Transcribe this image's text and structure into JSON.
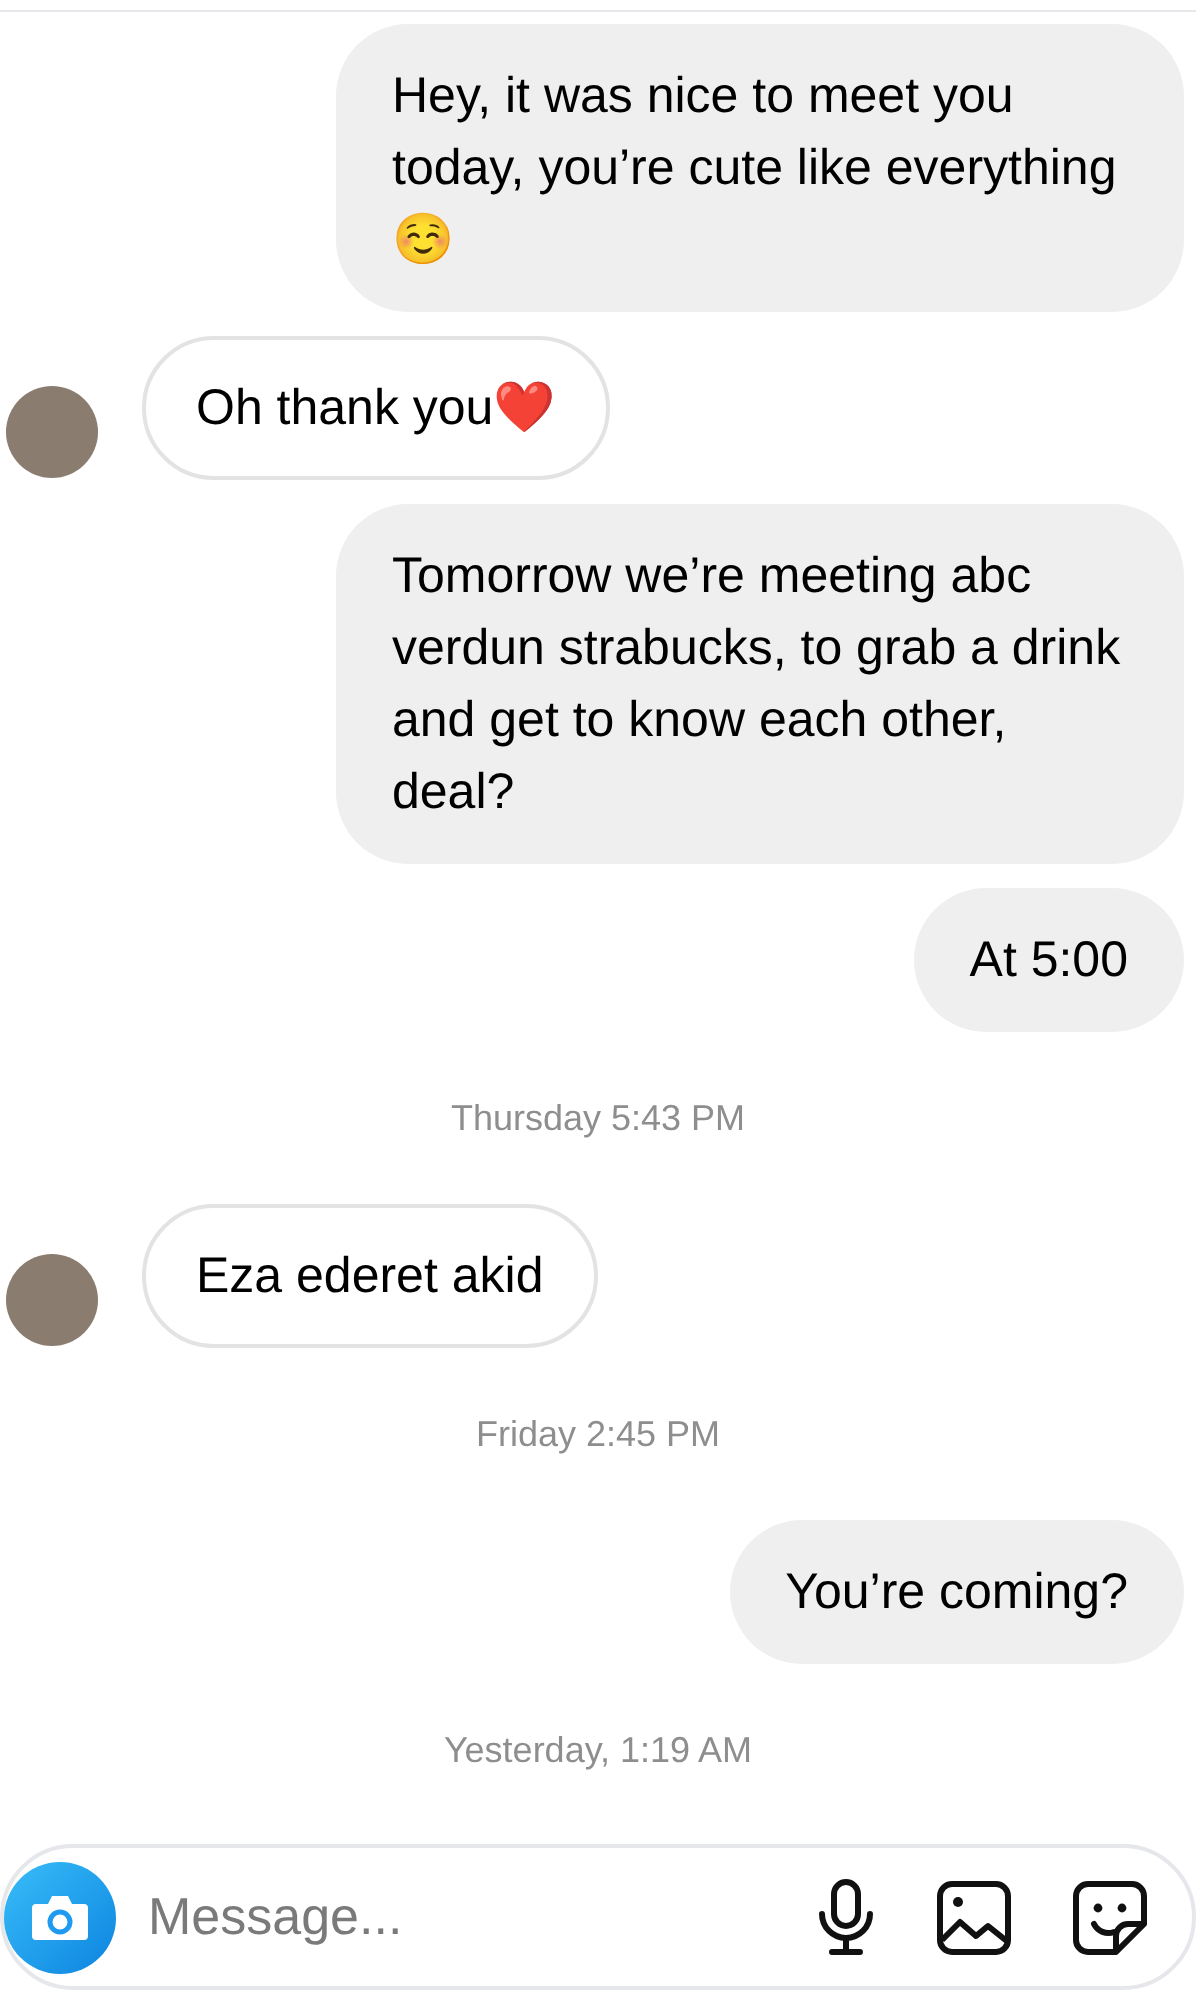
{
  "messages": [
    {
      "kind": "sent",
      "text": "Hey, it was nice to meet you today, you’re cute like everything ☺️"
    },
    {
      "kind": "received",
      "text": "Oh thank you❤️"
    },
    {
      "kind": "sent",
      "text": "Tomorrow we’re meeting abc verdun strabucks, to grab a drink and get to know each other, deal?"
    },
    {
      "kind": "sent",
      "text": "At 5:00"
    },
    {
      "kind": "timestamp",
      "text": "Thursday 5:43 PM"
    },
    {
      "kind": "received",
      "text": "Eza ederet akid"
    },
    {
      "kind": "timestamp",
      "text": "Friday 2:45 PM"
    },
    {
      "kind": "sent",
      "text": "You’re coming?"
    },
    {
      "kind": "timestamp",
      "text": "Yesterday, 1:19 AM"
    }
  ],
  "composer": {
    "placeholder": "Message..."
  }
}
